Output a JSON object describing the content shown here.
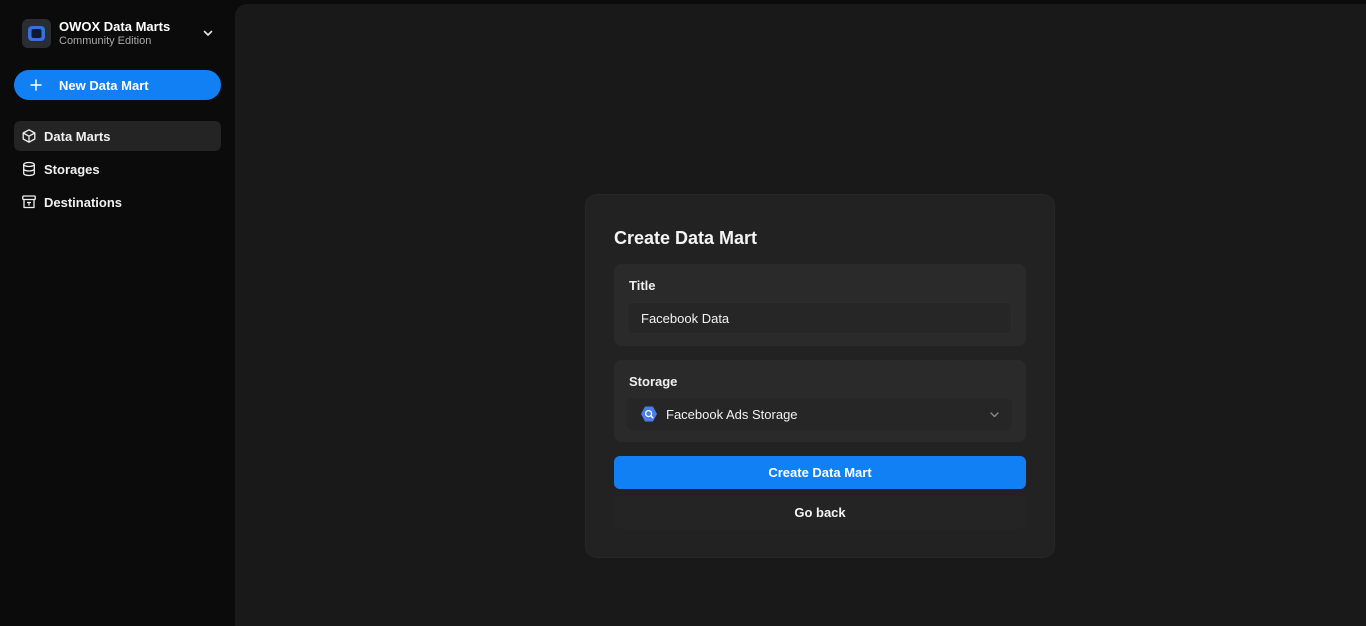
{
  "brand": {
    "name": "OWOX Data Marts",
    "edition": "Community Edition",
    "logo_icon": "owox-logo-icon",
    "accent": "#1280f5"
  },
  "sidebar": {
    "new_button": {
      "label": "New Data Mart",
      "icon": "plus-icon"
    },
    "items": [
      {
        "label": "Data Marts",
        "icon": "cube-icon",
        "active": true
      },
      {
        "label": "Storages",
        "icon": "database-icon",
        "active": false
      },
      {
        "label": "Destinations",
        "icon": "destination-icon",
        "active": false
      }
    ]
  },
  "form": {
    "title": "Create Data Mart",
    "title_field": {
      "label": "Title",
      "value": "Facebook Data"
    },
    "storage_field": {
      "label": "Storage",
      "value": "Facebook Ads Storage",
      "icon": "bigquery-icon"
    },
    "submit_label": "Create Data Mart",
    "back_label": "Go back"
  }
}
